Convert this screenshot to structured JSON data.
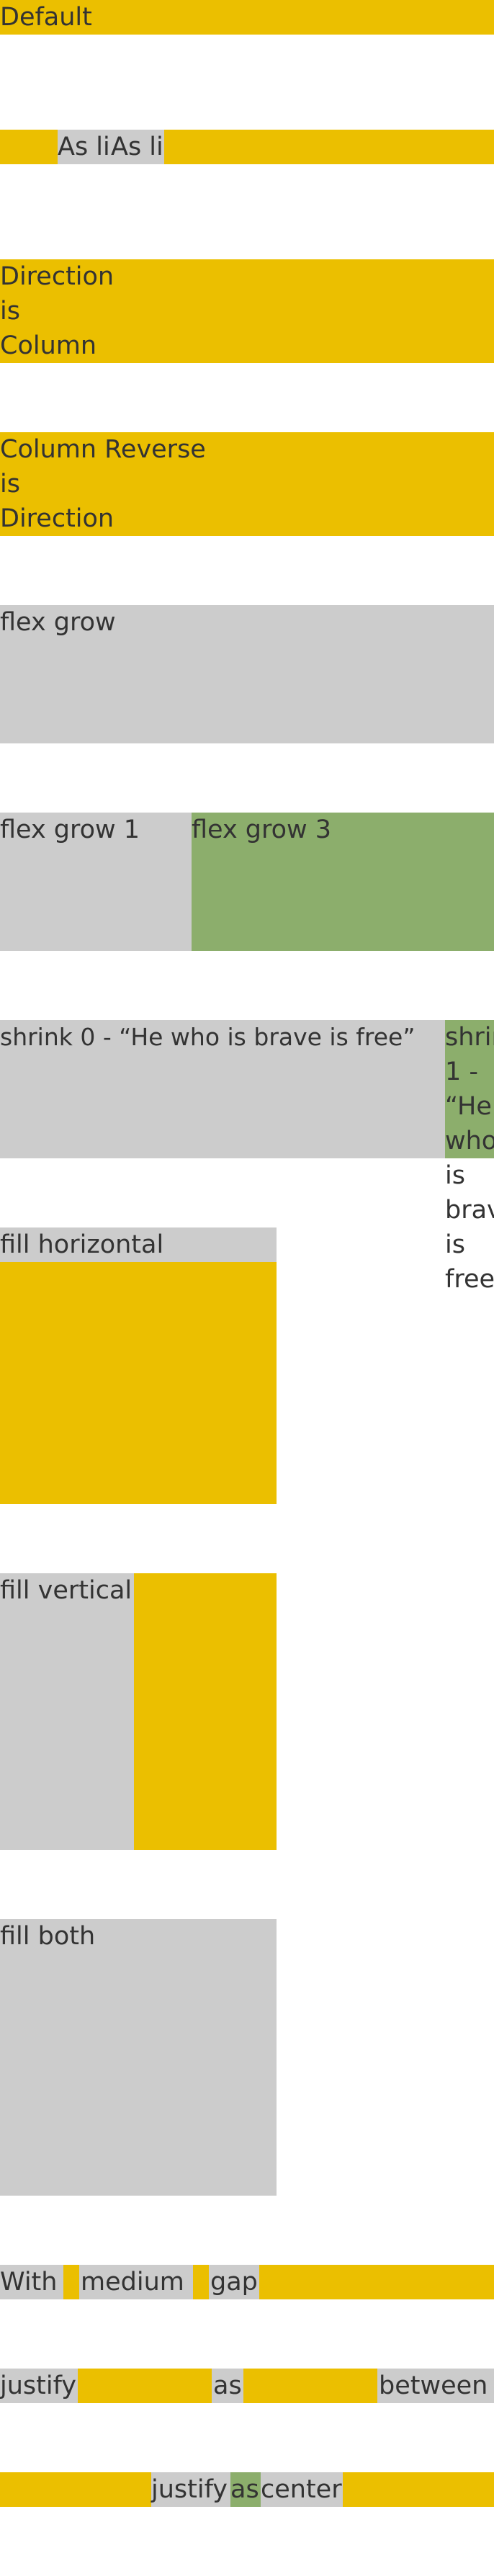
{
  "colors": {
    "yellow": "#ebbf00",
    "gray": "#cccccc",
    "green": "#8cae6c",
    "text": "#333333"
  },
  "default": {
    "label": "Default"
  },
  "as_li": {
    "items": [
      "As li",
      "As li"
    ]
  },
  "direction_column": {
    "lines": [
      "Direction",
      "is",
      "Column"
    ]
  },
  "column_reverse": {
    "lines": [
      "Column Reverse",
      "is",
      "Direction"
    ]
  },
  "flex_grow": {
    "label": "flex grow"
  },
  "flex_grow_pair": {
    "first": "flex grow 1",
    "second": "flex grow 3"
  },
  "shrink": {
    "first": "shrink 0 - “He who is brave is free”",
    "second_lines": [
      "shrink",
      "1 -",
      "“He",
      "who",
      "is",
      "brave",
      "is",
      "free”"
    ]
  },
  "fill_horizontal": {
    "label": "fill horizontal"
  },
  "fill_vertical": {
    "label": "fill vertical"
  },
  "fill_both": {
    "label": "fill both"
  },
  "gap": {
    "items": [
      "With",
      "medium",
      "gap"
    ]
  },
  "justify_between": {
    "items": [
      "justify",
      "as",
      "between"
    ]
  },
  "justify_center": {
    "items": [
      "justify",
      "as",
      "center"
    ]
  }
}
